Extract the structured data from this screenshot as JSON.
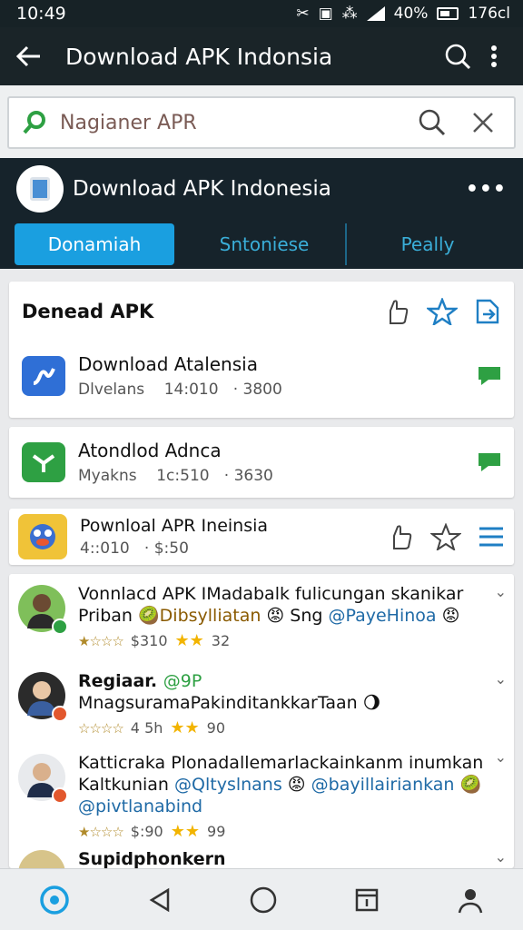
{
  "status_bar": {
    "time": "10:49",
    "battery": "40%",
    "network": "176cl"
  },
  "appbar": {
    "title": "Download APK Indonsia"
  },
  "search": {
    "value": "Nagianer APR"
  },
  "channel": {
    "title": "Download APK  Indonesia",
    "tabs": [
      "Donamiah",
      "Sntoniese",
      "Peally"
    ]
  },
  "section": {
    "title": "Denead APK",
    "items": [
      {
        "title": "Download Atalensia",
        "meta": "Dlvelans    14:010   · 3800",
        "icon_color": "#2f6fd6"
      },
      {
        "title": "Atondlod Adnca",
        "meta": "Myakns    1c:510   · 3630",
        "icon_color": "#2ea043"
      }
    ]
  },
  "featured": {
    "title": "Pownloal APR Ineinsia",
    "meta": "4::010   · $:50"
  },
  "posts": [
    {
      "line1": "Vonnlacd APK IMadabalk fulicungan skanikar",
      "line2a": "Priban 🥝",
      "line2b": "Dibsylliatan",
      "line2c": " 😡 Sng ",
      "line2d": "@PayeHinoa",
      "line2e": " 😡",
      "meta_a": "$310",
      "meta_b": "32"
    },
    {
      "line1a": "Regiaar. ",
      "line1b": "@9P",
      "line2": "MnagsuramaPakinditankkarTaan 🌖",
      "meta_a": "4 5h",
      "meta_b": "90"
    },
    {
      "line1": "Katticraka Plonadallemarlackainkanm inumkan",
      "line2a": "Kaltkunian ",
      "line2b": "@Qltyslnans",
      "line2c": " 😡 ",
      "line2d": "@bayillairiankan",
      "line2e": " 🥝",
      "line3": "@pivtlanabind",
      "meta_a": "$:90",
      "meta_b": "99"
    },
    {
      "line1": "Supidphonkern"
    }
  ],
  "colors": {
    "accent": "#1a9fe0",
    "header": "#16232b",
    "green": "#2ea043"
  }
}
